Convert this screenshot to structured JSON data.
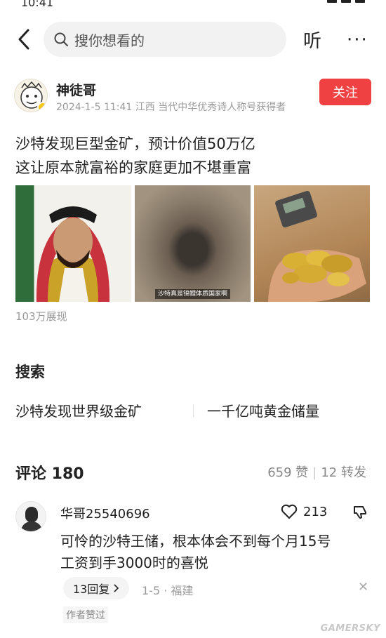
{
  "status_bar": {
    "time": "10:41"
  },
  "header": {
    "search_placeholder": "搜你想看的",
    "listen_label": "听",
    "more_label": "···"
  },
  "post": {
    "author_name": "神徒哥",
    "author_meta": "2024-1-5 11:41 江西 当代中华优秀诗人称号获得者",
    "follow_label": "关注",
    "text_line1": "沙特发现巨型金矿，预计价值50万亿",
    "text_line2": "这让原本就富裕的家庭更加不堪重富",
    "image2_caption": "沙特真是锦鲤体质国家啊",
    "views": "103万展现"
  },
  "search_section": {
    "title": "搜索",
    "suggestions": [
      "沙特发现世界级金矿",
      "一千亿吨黄金储量"
    ]
  },
  "comments": {
    "title": "评论 180",
    "likes": "659 赞",
    "reposts": "12 转发",
    "items": [
      {
        "user": "华哥25540696",
        "like_count": "213",
        "text_line1": "可怜的沙特王储，根本体会不到每个月15号",
        "text_line2": "工资到手3000时的喜悦",
        "replies_label": "13回复",
        "meta": "1-5 · 福建",
        "author_liked": "作者赞过"
      }
    ]
  },
  "watermark": {
    "text": "GAMERSKY"
  },
  "colors": {
    "accent": "#f04142",
    "muted": "#9a9a9a",
    "search_bg": "#f2f2f2"
  },
  "icons": [
    "back-arrow-icon",
    "search-icon",
    "heart-icon",
    "dislike-icon",
    "close-icon",
    "chevron-right-icon"
  ]
}
